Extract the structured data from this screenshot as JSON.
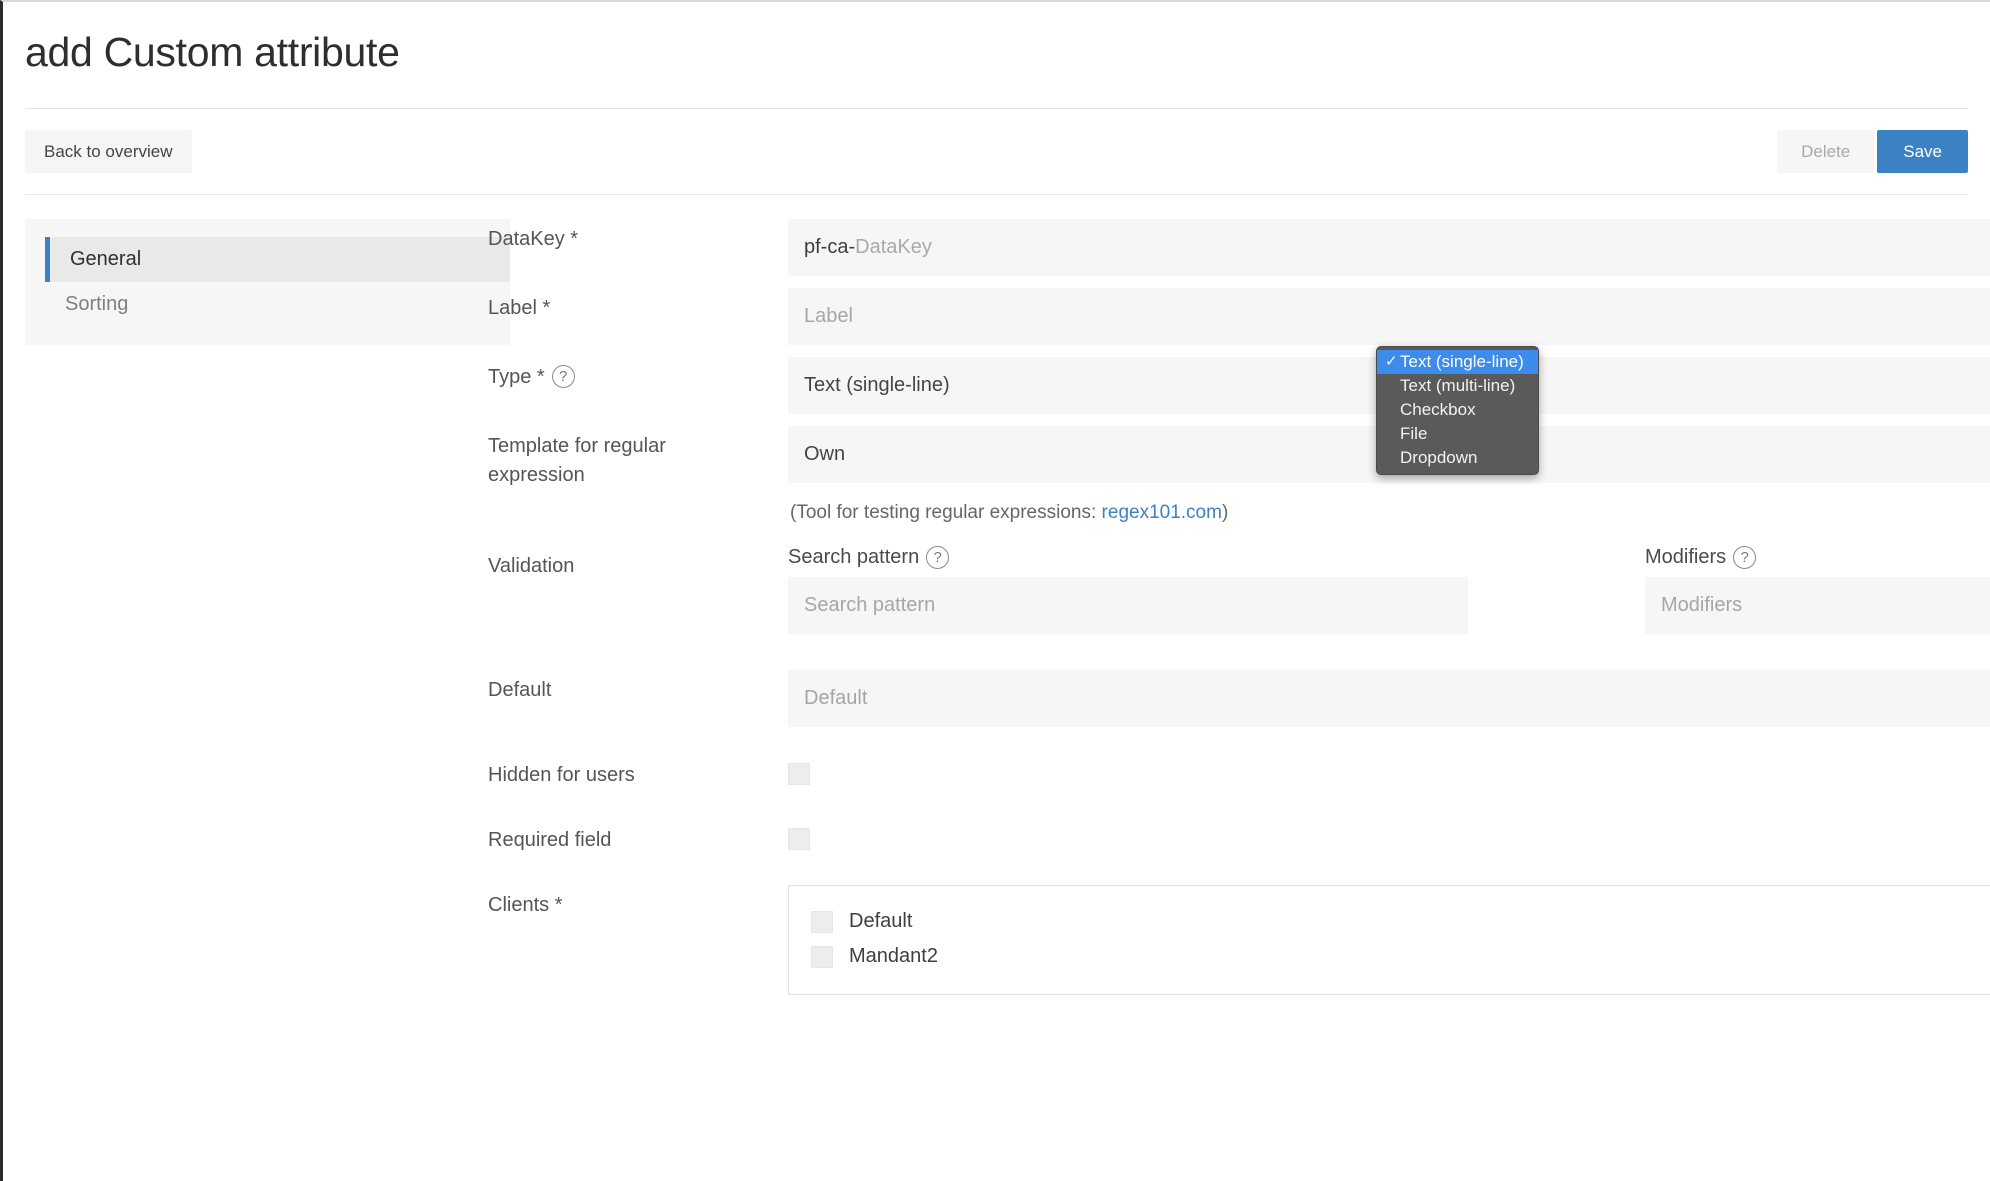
{
  "header": {
    "title": "add Custom attribute"
  },
  "actionbar": {
    "back_label": "Back to overview",
    "delete_label": "Delete",
    "save_label": "Save",
    "save_color": "#3b82c4",
    "delete_color": "#a9a9a9"
  },
  "sidebar": {
    "items": [
      {
        "label": "General",
        "active": true
      },
      {
        "label": "Sorting",
        "active": false
      }
    ],
    "accent_color": "#3b82c4"
  },
  "form": {
    "datakey": {
      "label": "DataKey *",
      "prefix": "pf-ca-",
      "placeholder": "DataKey",
      "value": ""
    },
    "label_field": {
      "label": "Label *",
      "placeholder": "Label",
      "value": ""
    },
    "type": {
      "label": "Type *",
      "help": "?",
      "value": "Text (single-line)",
      "options": [
        "Text (single-line)",
        "Text (multi-line)",
        "Checkbox",
        "File",
        "Dropdown"
      ],
      "selected_index": 0,
      "check_glyph": "✓"
    },
    "template": {
      "label": "Template for regular",
      "label_line2": "expression",
      "value": "Own"
    },
    "note": {
      "prefix": "(Tool for testing regular expressions: ",
      "link": "regex101.com",
      "suffix": ")"
    },
    "validation": {
      "label": "Validation",
      "search_pattern": {
        "label": "Search pattern",
        "help": "?",
        "placeholder": "Search pattern",
        "value": ""
      },
      "modifiers": {
        "label": "Modifiers",
        "help": "?",
        "placeholder": "Modifiers",
        "value": ""
      }
    },
    "default": {
      "label": "Default",
      "placeholder": "Default",
      "value": ""
    },
    "hidden_for_users": {
      "label": "Hidden for users",
      "checked": false
    },
    "required_field": {
      "label": "Required field",
      "checked": false
    },
    "clients": {
      "label": "Clients *",
      "items": [
        {
          "label": "Default",
          "checked": false
        },
        {
          "label": "Mandant2",
          "checked": false
        }
      ]
    }
  }
}
